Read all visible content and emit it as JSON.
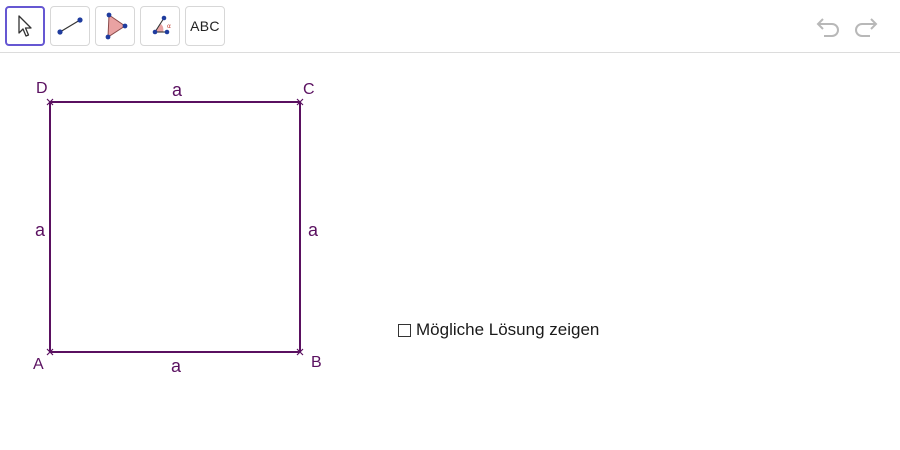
{
  "toolbar": {
    "tools": [
      {
        "name": "move-tool",
        "icon": "arrow-pointer-icon"
      },
      {
        "name": "segment-tool",
        "icon": "segment-icon"
      },
      {
        "name": "polygon-tool",
        "icon": "polygon-icon"
      },
      {
        "name": "angle-tool",
        "icon": "angle-icon"
      },
      {
        "name": "text-tool",
        "label": "ABC"
      }
    ],
    "undo_icon": "undo-icon",
    "redo_icon": "redo-icon"
  },
  "construction": {
    "points": {
      "A": "A",
      "B": "B",
      "C": "C",
      "D": "D"
    },
    "side_labels": {
      "bottom": "a",
      "top": "a",
      "left": "a",
      "right": "a"
    },
    "stroke_color": "#5a1060",
    "label_color": "#5a1060"
  },
  "solution_checkbox": {
    "label": "Mögliche Lösung zeigen",
    "checked": false
  }
}
